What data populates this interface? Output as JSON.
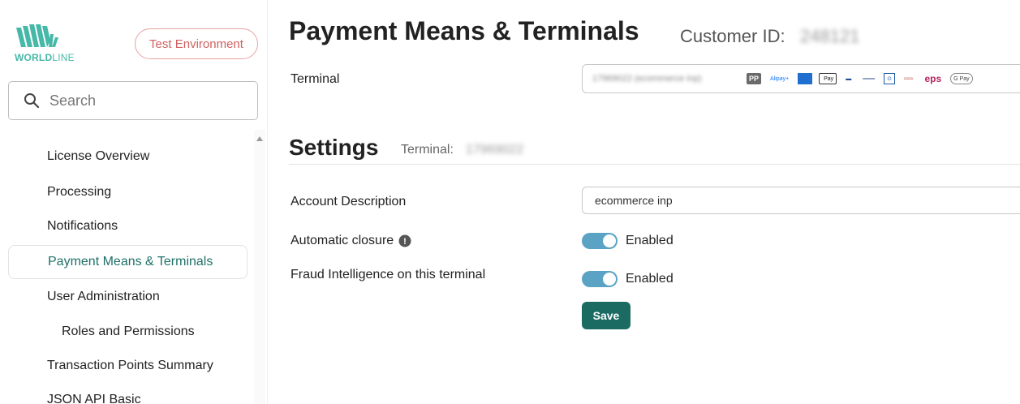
{
  "brand": {
    "logo_text_bold": "WORLD",
    "logo_text_light": "LINE",
    "logo_color": "#46b8a8",
    "environment_badge": "Test Environment"
  },
  "search": {
    "placeholder": "Search",
    "icon": "search-icon"
  },
  "sidebar": {
    "items": [
      {
        "label": "License Overview",
        "active": false
      },
      {
        "label": "Processing",
        "active": false
      },
      {
        "label": "Notifications",
        "active": false
      },
      {
        "label": "Payment Means & Terminals",
        "active": true
      },
      {
        "label": "User Administration",
        "active": false
      },
      {
        "label": "Roles and Permissions",
        "active": false,
        "sub": true
      },
      {
        "label": "Transaction Points Summary",
        "active": false
      },
      {
        "label": "JSON API Basic",
        "active": false
      }
    ],
    "active_color": "#1e7168"
  },
  "header": {
    "title": "Payment Means & Terminals",
    "customer_id_label": "Customer ID:",
    "customer_id_value": "248121"
  },
  "terminal": {
    "label": "Terminal",
    "selected_value": "17969022 (ecommerce inp)",
    "payment_means": [
      "PP",
      "Alipay+",
      "AMEX",
      " Pay",
      "BC",
      "bank transfer",
      "giropay",
      "PostFinance",
      "eps",
      "G Pay"
    ]
  },
  "settings": {
    "title": "Settings",
    "terminal_label": "Terminal:",
    "terminal_value": "17969022",
    "account_description": {
      "label": "Account Description",
      "value": "ecommerce inp"
    },
    "automatic_closure": {
      "label": "Automatic closure",
      "state": "Enabled",
      "on": true
    },
    "fraud_intelligence": {
      "label": "Fraud Intelligence on this terminal",
      "state": "Enabled",
      "on": true
    },
    "save_label": "Save",
    "toggle_color": "#5aa3c4",
    "save_color": "#1c6b63"
  }
}
